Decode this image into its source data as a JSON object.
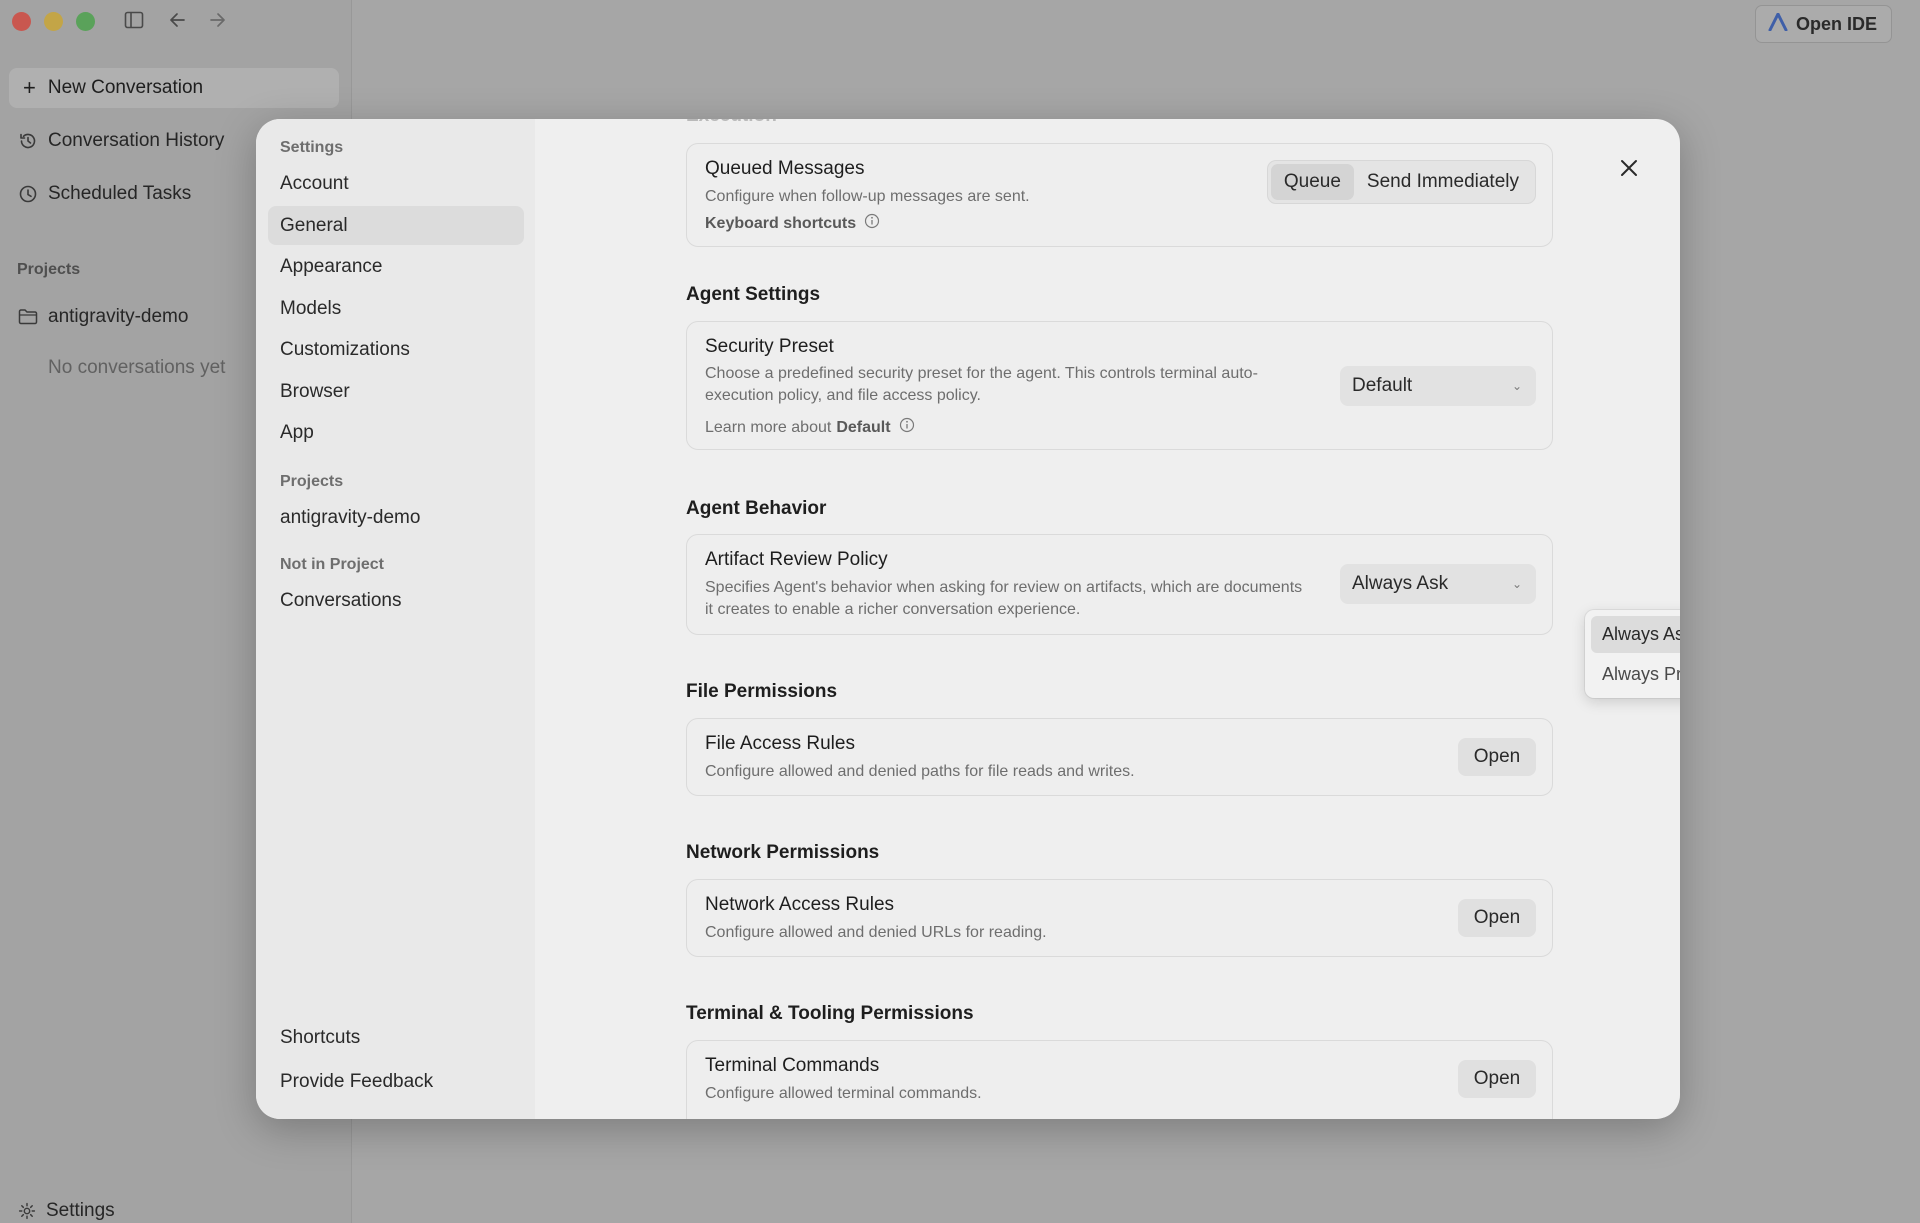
{
  "app": {
    "new_conversation": "New Conversation",
    "nav": {
      "history": "Conversation History",
      "scheduled": "Scheduled Tasks"
    },
    "projects_label": "Projects",
    "project_name": "antigravity-demo",
    "no_conversations": "No conversations yet",
    "settings": "Settings",
    "open_ide": "Open IDE"
  },
  "settings_nav": {
    "header": "Settings",
    "items": [
      "Account",
      "General",
      "Appearance",
      "Models",
      "Customizations",
      "Browser",
      "App"
    ],
    "active": "General",
    "projects_label": "Projects",
    "project": "antigravity-demo",
    "not_in_project_label": "Not in Project",
    "conversations": "Conversations",
    "shortcuts": "Shortcuts",
    "feedback": "Provide Feedback"
  },
  "content": {
    "execution_title": "Execution",
    "queued": {
      "title": "Queued Messages",
      "desc": "Configure when follow-up messages are sent.",
      "link": "Keyboard shortcuts",
      "options": [
        "Queue",
        "Send Immediately"
      ],
      "selected": "Queue"
    },
    "agent_settings_title": "Agent Settings",
    "security": {
      "title": "Security Preset",
      "desc": "Choose a predefined security preset for the agent. This controls terminal auto-execution policy, and file access policy.",
      "link_prefix": "Learn more about",
      "link_bold": "Default",
      "value": "Default"
    },
    "agent_behavior_title": "Agent Behavior",
    "artifact": {
      "title": "Artifact Review Policy",
      "desc": "Specifies Agent's behavior when asking for review on artifacts, which are documents it creates to enable a richer conversation experience.",
      "value": "Always Ask",
      "options": [
        "Always Ask",
        "Always Proceed"
      ]
    },
    "file_permissions_title": "File Permissions",
    "file_access": {
      "title": "File Access Rules",
      "desc": "Configure allowed and denied paths for file reads and writes.",
      "button": "Open"
    },
    "network_permissions_title": "Network Permissions",
    "network_access": {
      "title": "Network Access Rules",
      "desc": "Configure allowed and denied URLs for reading.",
      "button": "Open"
    },
    "terminal_title": "Terminal & Tooling Permissions",
    "terminal": {
      "title": "Terminal Commands",
      "desc": "Configure allowed terminal commands.",
      "button": "Open"
    }
  }
}
